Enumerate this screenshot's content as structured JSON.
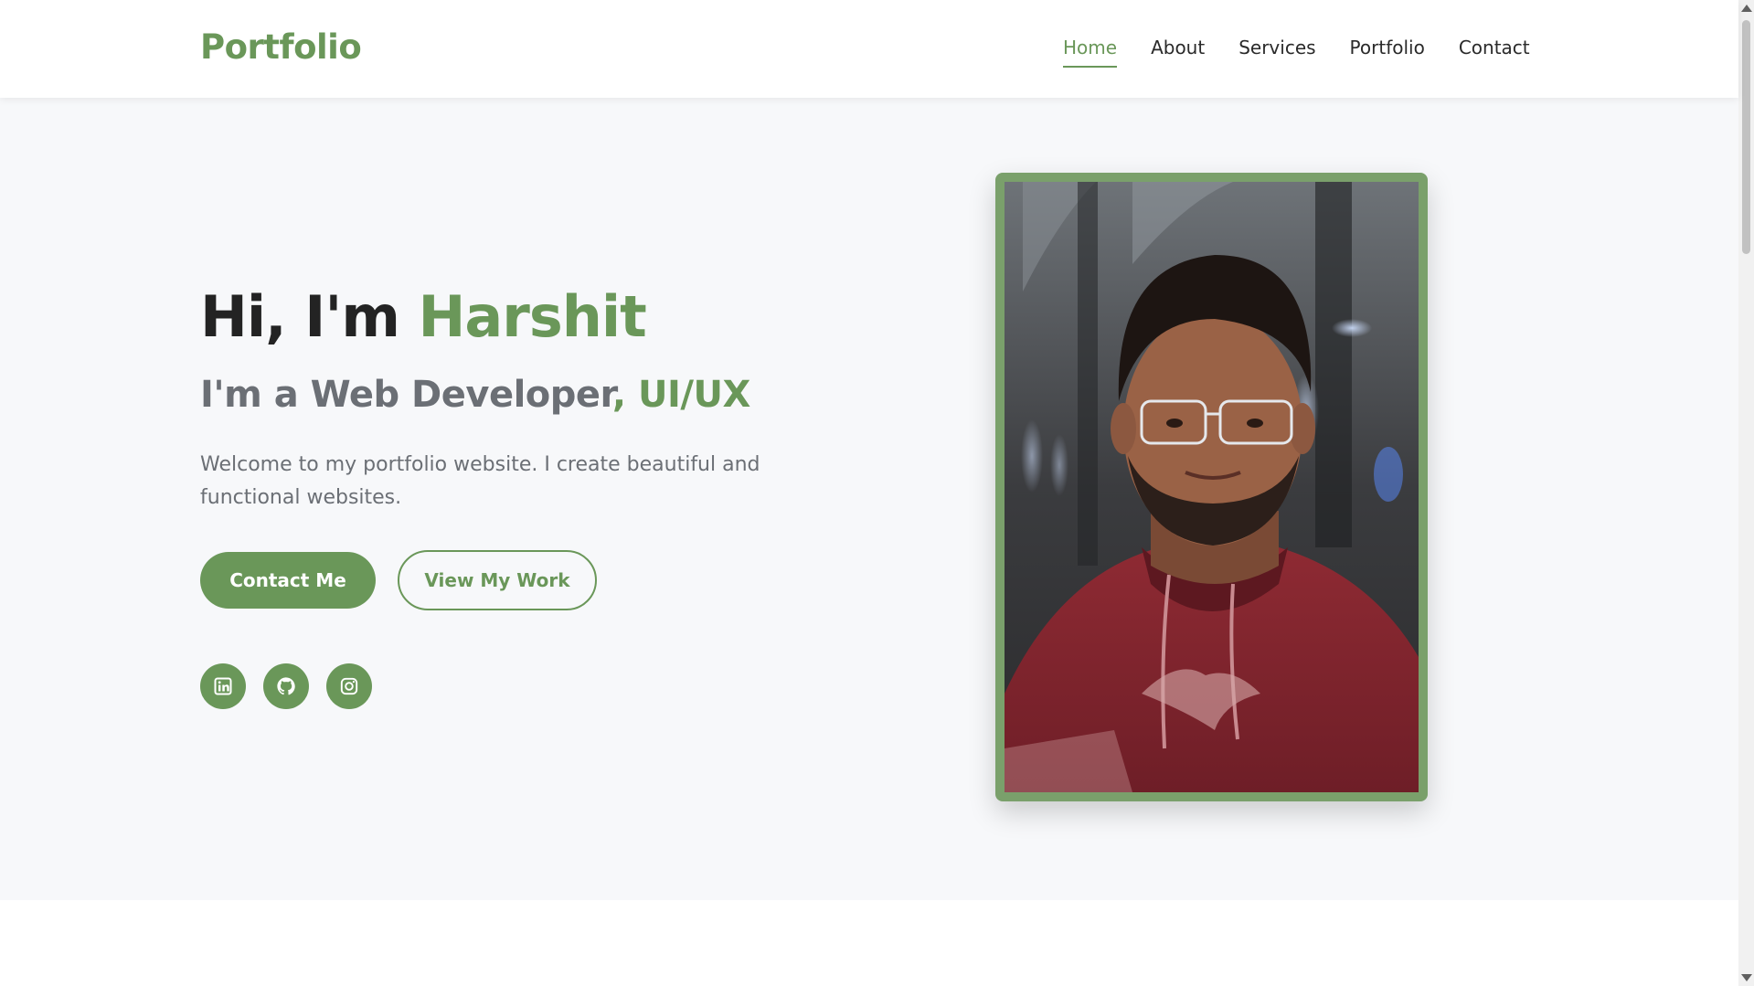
{
  "header": {
    "logo": "Portfolio",
    "nav": [
      {
        "label": "Home",
        "active": true
      },
      {
        "label": "About"
      },
      {
        "label": "Services"
      },
      {
        "label": "Portfolio"
      },
      {
        "label": "Contact"
      }
    ]
  },
  "hero": {
    "greeting_prefix": "Hi, I'm",
    "name": "Harshit",
    "role_prefix": "I'm a Web Developer",
    "role_highlight": ", UI/UX",
    "intro": "Welcome to my portfolio website. I create beautiful and functional websites.",
    "primary_button": "Contact Me",
    "secondary_button": "View My Work",
    "social": [
      {
        "icon": "linkedin-icon"
      },
      {
        "icon": "github-icon"
      },
      {
        "icon": "instagram-icon"
      }
    ]
  },
  "colors": {
    "accent": "#6a9759",
    "heading": "#232323",
    "muted": "#6b6f75",
    "hero_bg": "#f7f8fa"
  }
}
